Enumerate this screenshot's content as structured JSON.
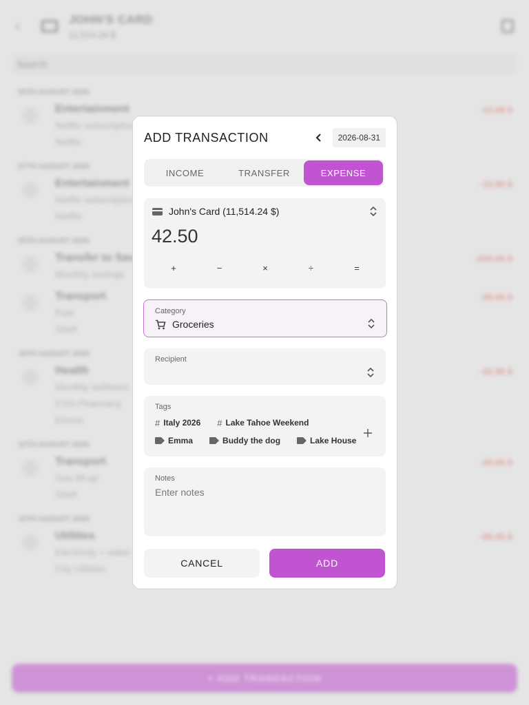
{
  "background": {
    "header": {
      "title": "JOHN'S CARD",
      "subtitle": "11,514.24 $"
    },
    "search_placeholder": "Search",
    "fab_label": "+  ADD TRANSACTION",
    "groups": [
      {
        "date": "30TH AUGUST 2026",
        "rows": [
          {
            "name": "Entertainment",
            "lines": [
              "Netflix subscription",
              "Netflix"
            ],
            "amount": "-15.99 $"
          }
        ]
      },
      {
        "date": "27TH AUGUST 2026",
        "rows": [
          {
            "name": "Entertainment",
            "lines": [
              "Netflix subscription",
              "Netflix"
            ],
            "amount": "-15.99 $"
          }
        ]
      },
      {
        "date": "25TH AUGUST 2026",
        "rows": [
          {
            "name": "Transfer to Savings",
            "lines": [
              "Monthly savings"
            ],
            "amount": "-200.00 $"
          },
          {
            "name": "Transport",
            "lines": [
              "Fuel",
              "Shell"
            ],
            "amount": "-38.00 $"
          }
        ]
      },
      {
        "date": "18TH AUGUST 2026",
        "rows": [
          {
            "name": "Health",
            "lines": [
              "Monthly wellness",
              "CVS Pharmacy",
              "Emma"
            ],
            "amount": "-32.98 $"
          }
        ]
      },
      {
        "date": "12TH AUGUST 2026",
        "rows": [
          {
            "name": "Transport",
            "lines": [
              "Gas fill-up",
              "Shell"
            ],
            "amount": "-45.00 $"
          }
        ]
      },
      {
        "date": "10TH AUGUST 2026",
        "rows": [
          {
            "name": "Utilities",
            "lines": [
              "Electricity + water",
              "City Utilities"
            ],
            "amount": "-96.45 $"
          }
        ]
      }
    ]
  },
  "dialog": {
    "title": "ADD TRANSACTION",
    "date": "2026-08-31",
    "tabs": [
      {
        "label": "INCOME",
        "active": false
      },
      {
        "label": "TRANSFER",
        "active": false
      },
      {
        "label": "EXPENSE",
        "active": true
      }
    ],
    "account": "John's Card (11,514.24 $)",
    "amount": "42.50",
    "operators": [
      "+",
      "−",
      "×",
      "÷",
      "="
    ],
    "category": {
      "label": "Category",
      "value": "Groceries"
    },
    "recipient": {
      "label": "Recipient",
      "value": ""
    },
    "tags": {
      "label": "Tags",
      "hashtags": [
        "Italy 2026",
        "Lake Tahoe Weekend"
      ],
      "labels": [
        "Emma",
        "Buddy the dog",
        "Lake House"
      ]
    },
    "notes": {
      "label": "Notes",
      "placeholder": "Enter notes"
    },
    "cancel_label": "CANCEL",
    "add_label": "ADD"
  },
  "colors": {
    "accent": "#c054d1",
    "negative": "#d86a6a"
  }
}
